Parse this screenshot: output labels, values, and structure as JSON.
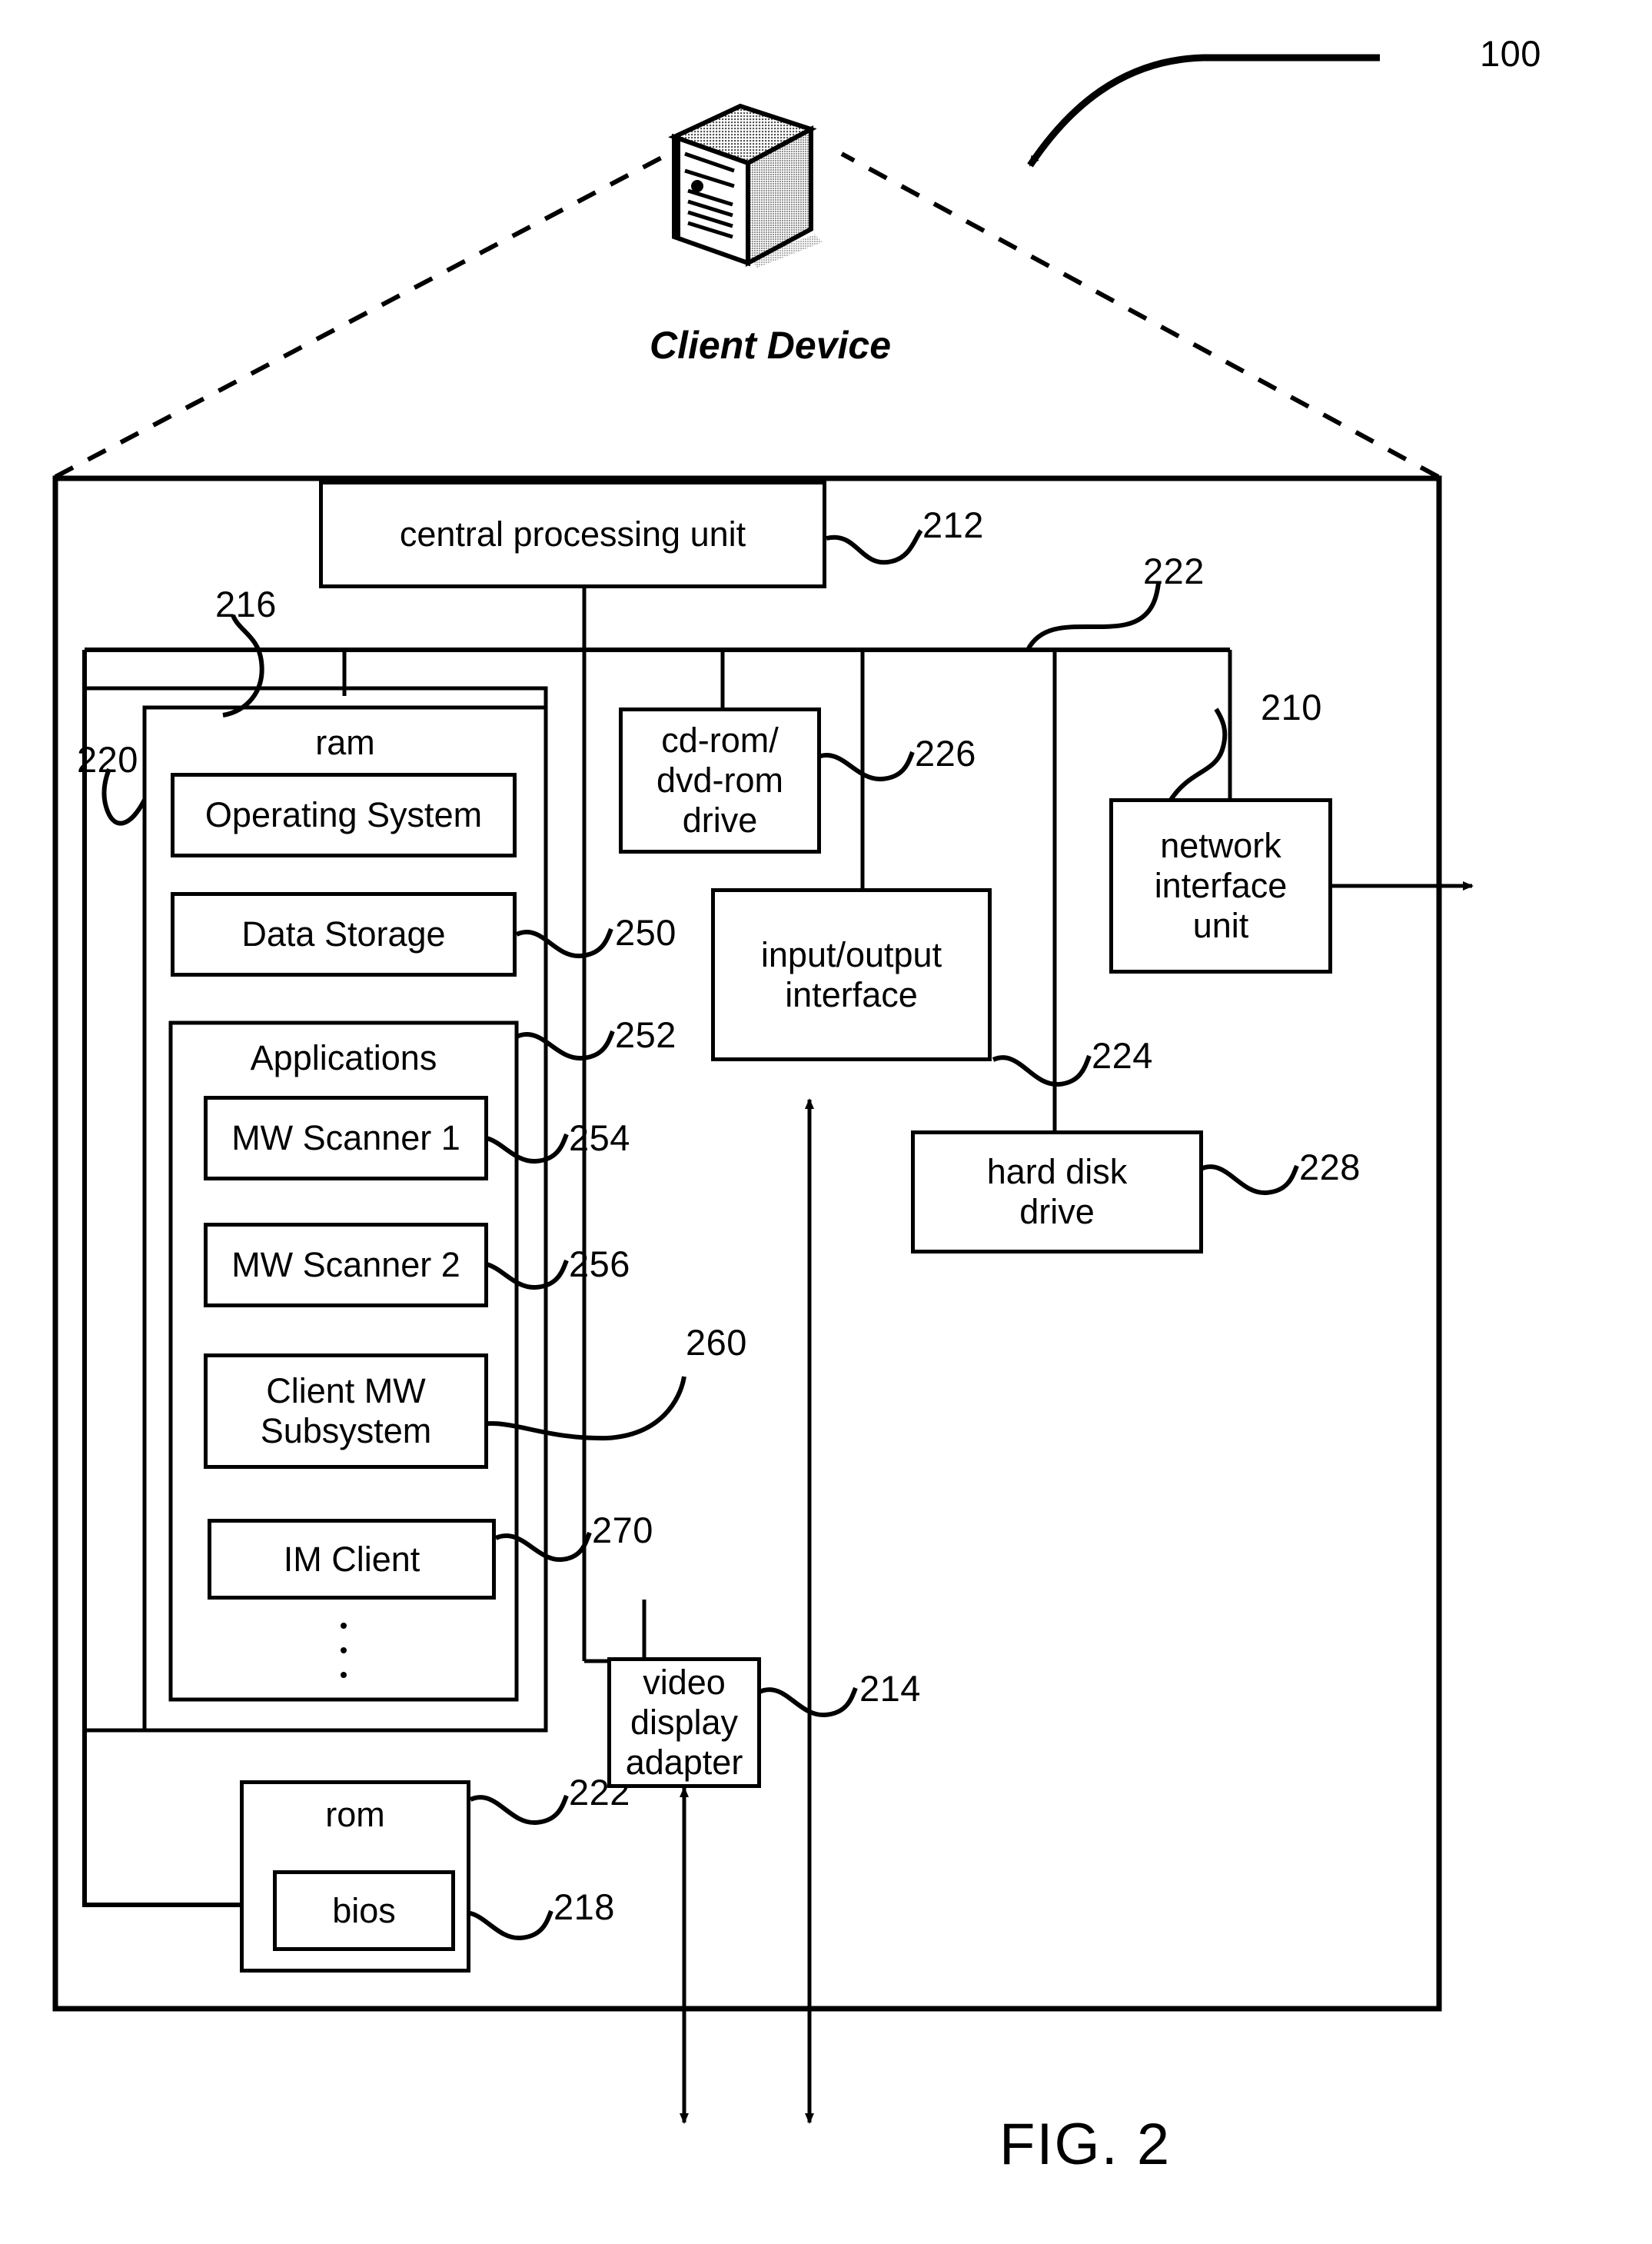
{
  "figure": {
    "fig_label": "FIG. 2",
    "system_ref": "100",
    "device_title": "Client Device",
    "device_icon": "computer-tower-icon"
  },
  "blocks": {
    "cpu": {
      "label": "central processing unit",
      "ref": "212"
    },
    "memory": {
      "ref": "216"
    },
    "ram": {
      "label": "ram",
      "ref": "220"
    },
    "os": {
      "label": "Operating System"
    },
    "data_store": {
      "label": "Data Storage",
      "ref": "250"
    },
    "apps": {
      "label": "Applications",
      "ref": "252"
    },
    "scanner1": {
      "label": "MW Scanner 1",
      "ref": "254"
    },
    "scanner2": {
      "label": "MW Scanner 2",
      "ref": "256"
    },
    "client_mw": {
      "label": "Client MW\nSubsystem",
      "ref": "260"
    },
    "im_client": {
      "label": "IM Client",
      "ref": "270"
    },
    "rom": {
      "label": "rom",
      "ref": "222"
    },
    "bios": {
      "label": "bios",
      "ref": "218"
    },
    "cdrom": {
      "label": "cd-rom/\ndvd-rom\ndrive",
      "ref": "226"
    },
    "io": {
      "label": "input/output\ninterface",
      "ref": "224"
    },
    "nic": {
      "label": "network\ninterface\nunit",
      "ref": "210"
    },
    "hdd": {
      "label": "hard disk\ndrive",
      "ref": "228"
    },
    "video": {
      "label": "video\ndisplay\nadapter",
      "ref": "214"
    },
    "bus": {
      "ref": "222"
    }
  },
  "colors": {
    "ink": "#000000",
    "paper": "#ffffff"
  }
}
